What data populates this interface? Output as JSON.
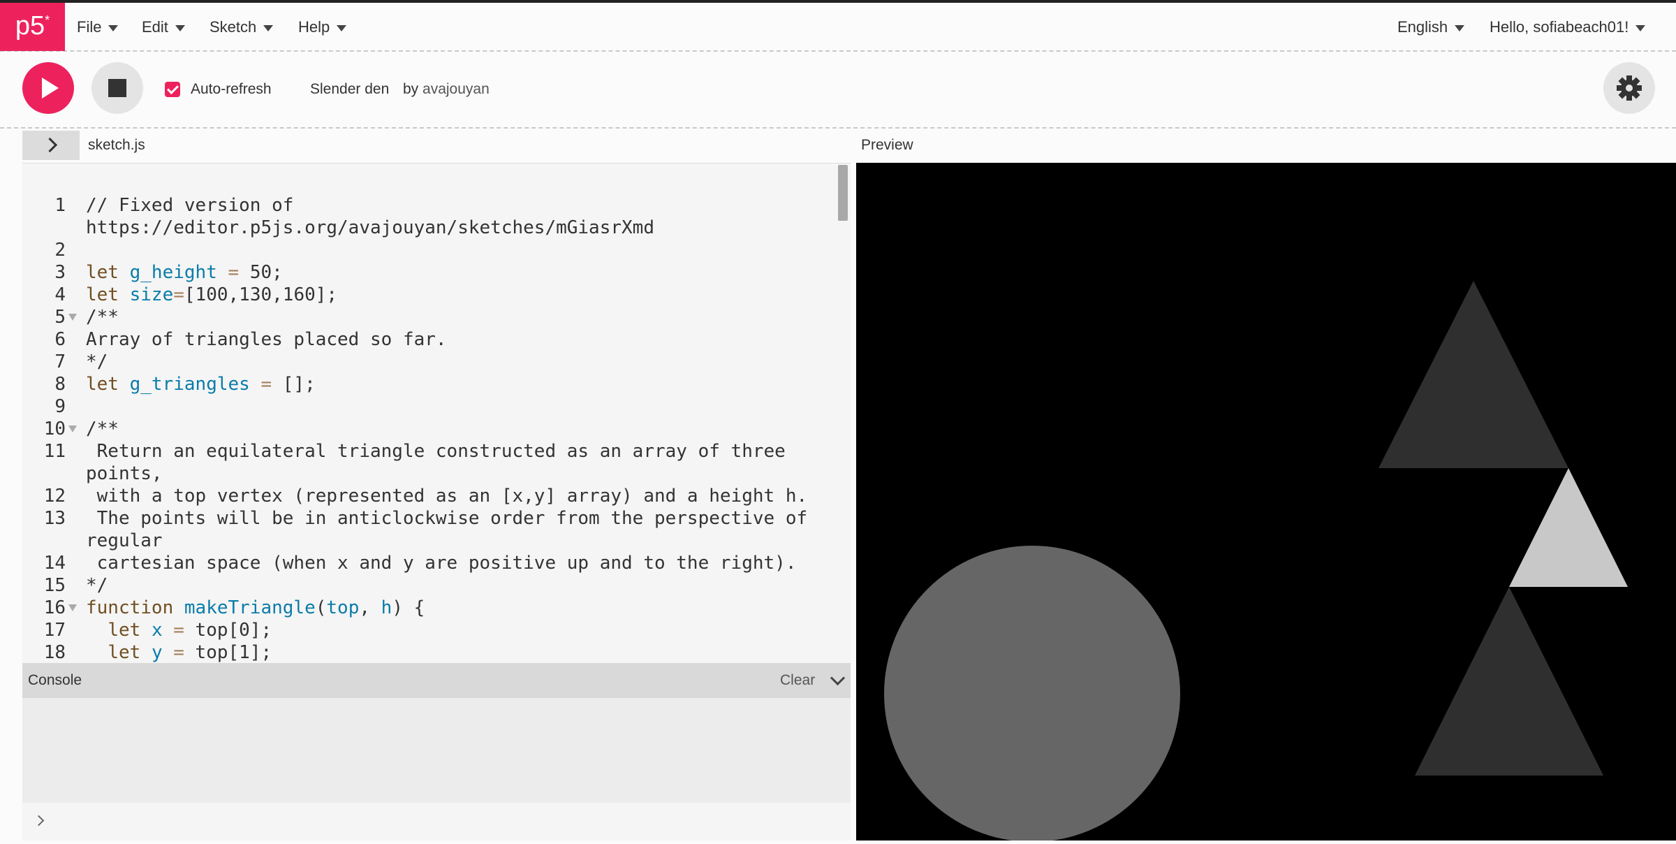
{
  "app": {
    "logo": "p5",
    "logo_star": "*"
  },
  "menu": {
    "file": "File",
    "edit": "Edit",
    "sketch": "Sketch",
    "help": "Help",
    "language": "English",
    "user": "Hello, sofiabeach01!"
  },
  "toolbar": {
    "auto_refresh_label": "Auto-refresh",
    "auto_refresh_checked": true,
    "sketch_name": "Slender den",
    "by": "by",
    "author": "avajouyan"
  },
  "editor": {
    "file_name": "sketch.js",
    "line_numbers": [
      "1",
      "2",
      "3",
      "4",
      "5",
      "6",
      "7",
      "8",
      "9",
      "10",
      "11",
      "12",
      "13",
      "14",
      "15",
      "16",
      "17",
      "18"
    ],
    "lines": [
      "// Fixed version of",
      "https://editor.p5js.org/avajouyan/sketches/mGiasrXmd",
      "",
      "let g_height = 50;",
      "let size=[100,130,160];",
      "/**",
      "Array of triangles placed so far.",
      "*/",
      "let g_triangles = [];",
      "",
      "/**",
      " Return an equilateral triangle constructed as an array of three",
      "points,",
      " with a top vertex (represented as an [x,y] array) and a height h.",
      " The points will be in anticlockwise order from the perspective of",
      "regular",
      " cartesian space (when x and y are positive up and to the right).",
      "*/",
      "function makeTriangle(top, h) {",
      "  let x = top[0];",
      "  let y = top[1];"
    ]
  },
  "preview": {
    "label": "Preview"
  },
  "console": {
    "label": "Console",
    "clear_label": "Clear"
  },
  "colors": {
    "accent": "#ed225d",
    "preview_bg": "#000000"
  }
}
